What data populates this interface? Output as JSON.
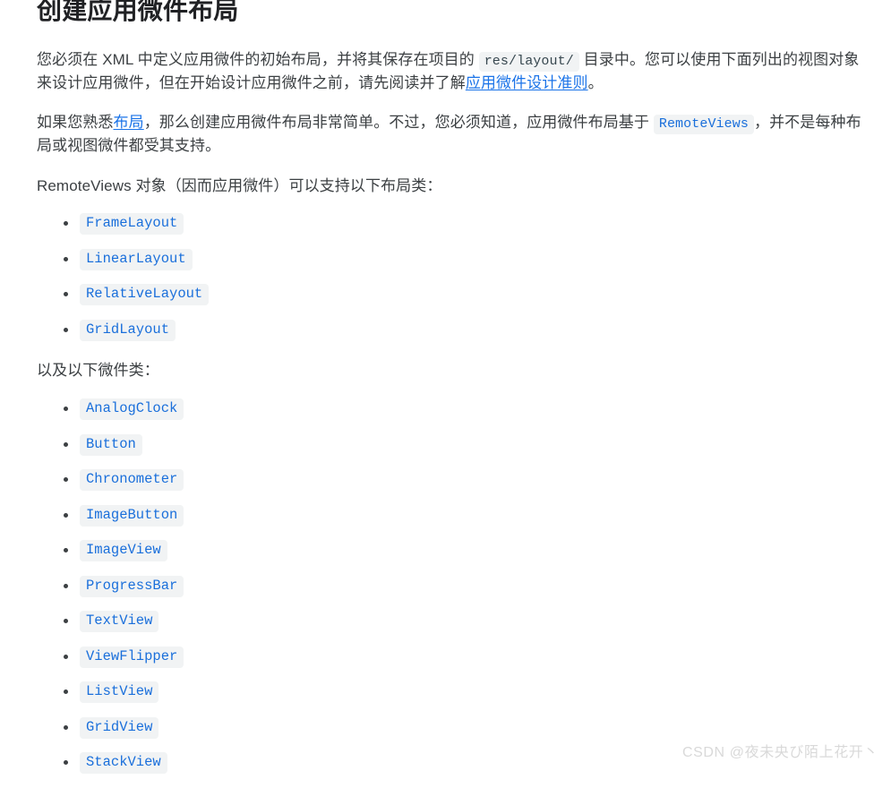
{
  "page": {
    "title": "创建应用微件布局",
    "background_color": "#ffffff",
    "text_color": "#3c4043",
    "link_color": "#1a73e8",
    "code_chip_background": "#f1f3f4",
    "code_api_color": "#1a6fdb"
  },
  "paragraphs": {
    "p1": {
      "part1": "您必须在 XML 中定义应用微件的初始布局，并将其保存在项目的",
      "code": "res/layout/",
      "part2": "目录中。您可以使用下面列出的视图对象来设计应用微件，但在开始设计应用微件之前，请先阅读并了解",
      "link": "应用微件设计准则",
      "part3": "。"
    },
    "p2": {
      "part1": "如果您熟悉",
      "link": "布局",
      "part2": "，那么创建应用微件布局非常简单。不过，您必须知道，应用微件布局基于",
      "code": "RemoteViews",
      "part3": "，并不是每种布局或视图微件都受其支持。"
    },
    "p3": {
      "text": "RemoteViews 对象（因而应用微件）可以支持以下布局类："
    },
    "p4": {
      "text": "以及以下微件类："
    }
  },
  "layout_classes": [
    "FrameLayout",
    "LinearLayout",
    "RelativeLayout",
    "GridLayout"
  ],
  "widget_classes": [
    "AnalogClock",
    "Button",
    "Chronometer",
    "ImageButton",
    "ImageView",
    "ProgressBar",
    "TextView",
    "ViewFlipper",
    "ListView",
    "GridView",
    "StackView"
  ],
  "watermark": {
    "text": "CSDN @夜未央び陌上花开丶"
  }
}
